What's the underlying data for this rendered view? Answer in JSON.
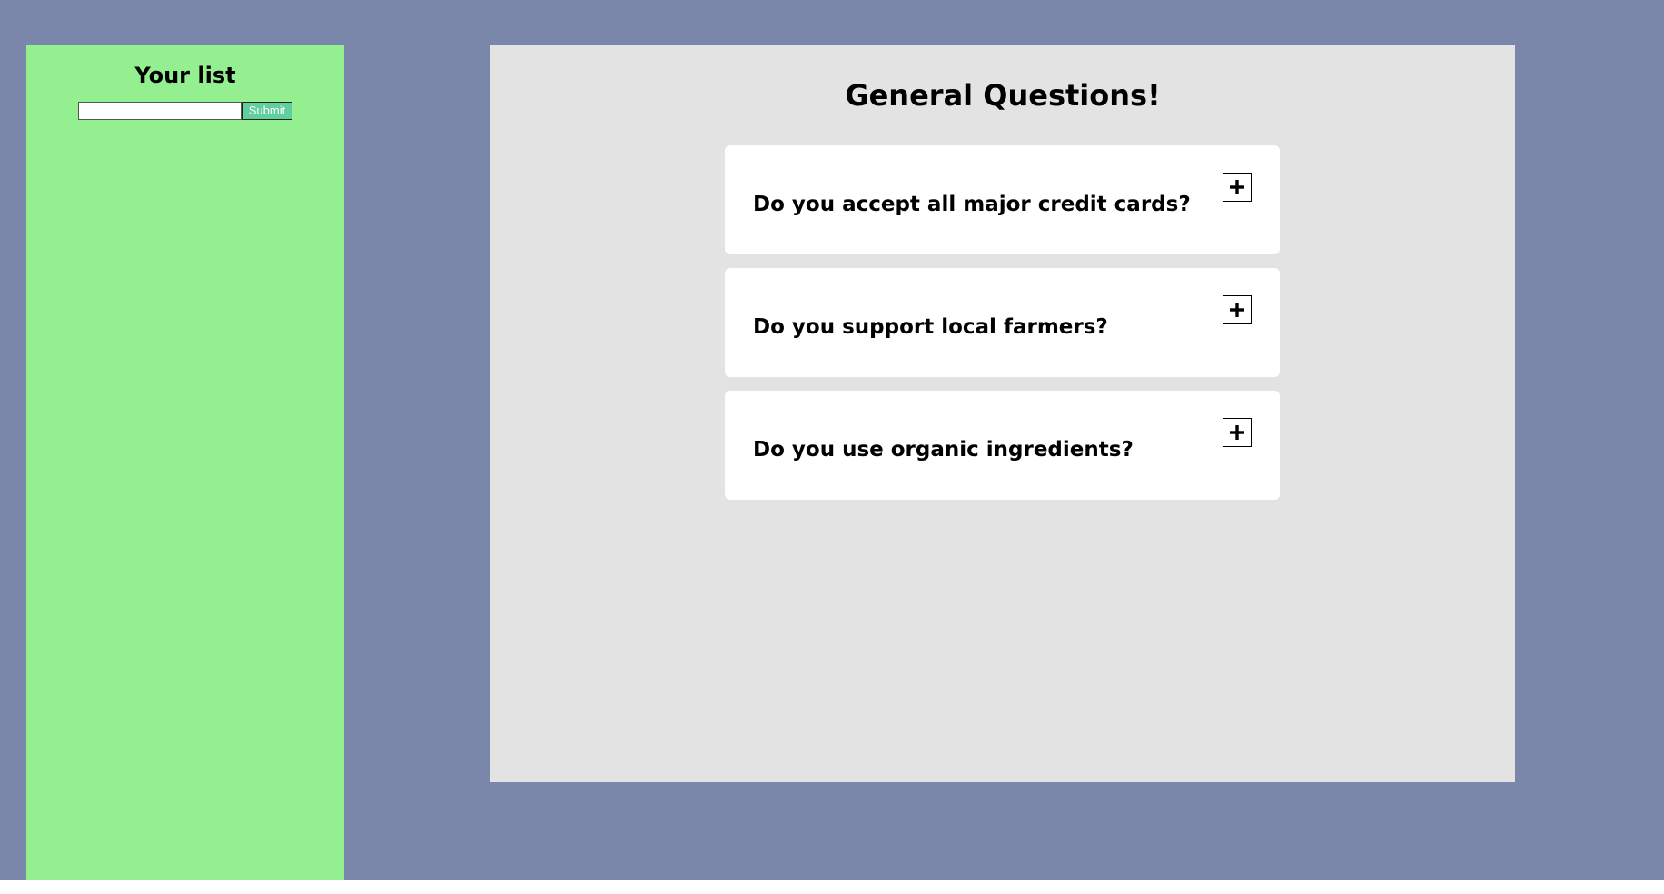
{
  "sidebar": {
    "title": "Your list",
    "input_value": "",
    "input_placeholder": "",
    "submit_label": "Submit"
  },
  "main": {
    "title": "General Questions!",
    "faqs": [
      {
        "question": "Do you accept all major credit cards?",
        "toggle_icon": "plus-icon"
      },
      {
        "question": "Do you support local farmers?",
        "toggle_icon": "plus-icon"
      },
      {
        "question": "Do you use organic ingredients?",
        "toggle_icon": "plus-icon"
      }
    ]
  },
  "colors": {
    "page_background": "#7a87aa",
    "sidebar_background": "#93ef8f",
    "panel_background": "#e3e3e3",
    "card_background": "#ffffff",
    "submit_background": "#5fcf9e"
  }
}
